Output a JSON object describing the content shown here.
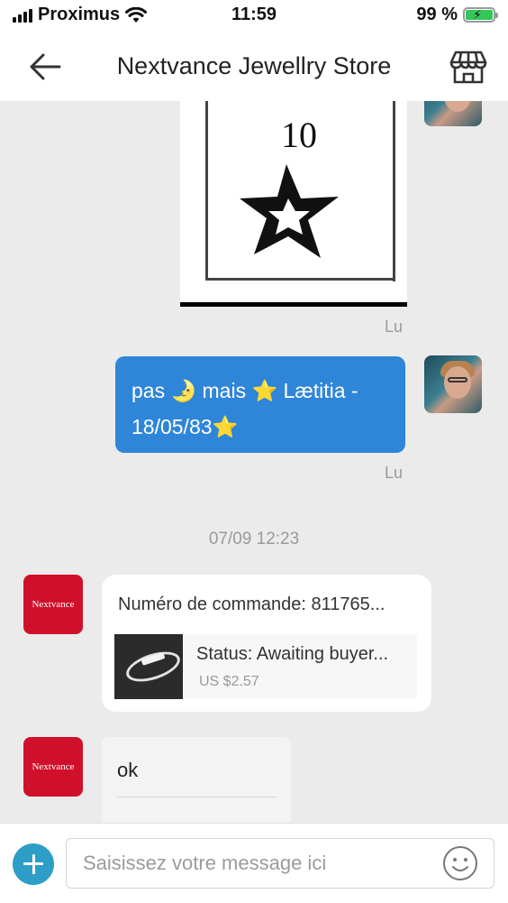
{
  "status_bar": {
    "carrier": "Proximus",
    "time": "11:59",
    "battery": "99 %"
  },
  "header": {
    "title": "Nextvance Jewellry Store"
  },
  "messages": {
    "image_message": {
      "number": "10"
    },
    "read_label_1": "Lu",
    "blue_message": {
      "text_part1": "pas ",
      "emoji1": "🌛",
      "text_part2": " mais ",
      "emoji2": "⭐",
      "text_part3": " Lætitia - 18/05/83",
      "emoji3": "⭐"
    },
    "read_label_2": "Lu",
    "timestamp": "07/09 12:23",
    "store_avatar_text": "Nextvance",
    "order_card": {
      "title": "Numéro de commande: 811765...",
      "status": "Status:  Awaiting buyer...",
      "price": "US $2.57"
    },
    "ok_message": "ok"
  },
  "input": {
    "placeholder": "Saisissez votre message ici"
  },
  "colors": {
    "accent_blue": "#2f86d8",
    "plus_button": "#2c9ec8",
    "brand_red": "#d0102a",
    "battery_green": "#33c759"
  }
}
